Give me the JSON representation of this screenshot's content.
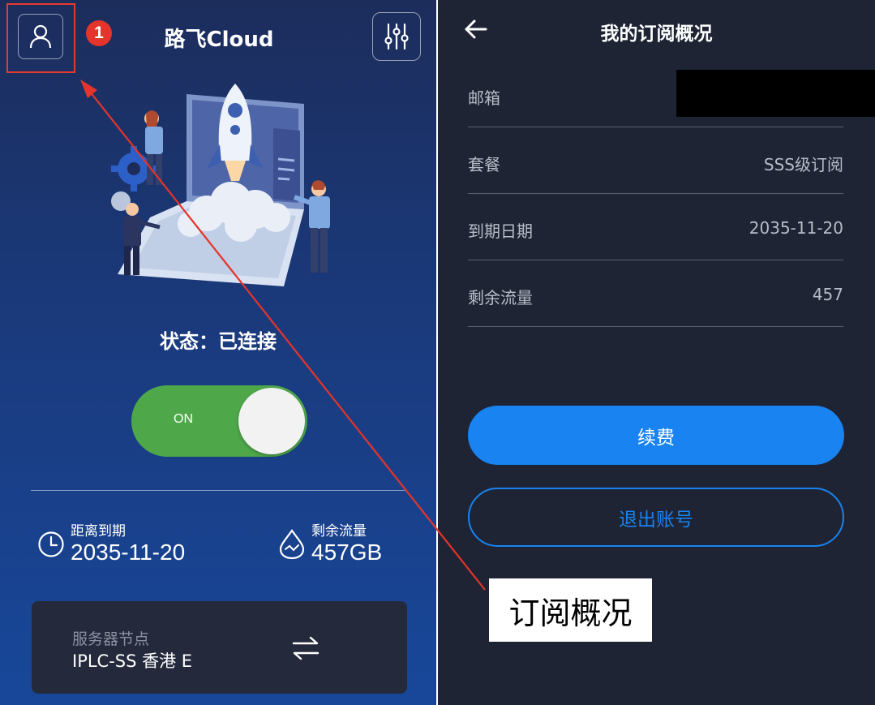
{
  "left": {
    "app_title": "路飞Cloud",
    "step_badge": "1",
    "status_text": "状态：已连接",
    "toggle_label": "ON",
    "expire": {
      "caption": "距离到期",
      "value": "2035-11-20"
    },
    "traffic": {
      "caption": "剩余流量",
      "value": "457GB"
    },
    "server": {
      "caption": "服务器节点",
      "value": "IPLC-SS 香港 E"
    }
  },
  "right": {
    "title": "我的订阅概况",
    "rows": [
      {
        "label": "邮箱",
        "value": ""
      },
      {
        "label": "套餐",
        "value": "SSS级订阅"
      },
      {
        "label": "到期日期",
        "value": "2035-11-20"
      },
      {
        "label": "剩余流量",
        "value": "457"
      }
    ],
    "renew_label": "续费",
    "logout_label": "退出账号"
  },
  "annotation": {
    "callout_text": "订阅概况"
  },
  "icons": {
    "user": "user-icon",
    "settings": "sliders-icon",
    "back": "arrow-left-icon",
    "clock": "clock-icon",
    "drop": "water-drop-icon",
    "swap": "swap-icon"
  },
  "colors": {
    "toggle_on": "#4ea84a",
    "accent_blue": "#1883f1",
    "annotation_red": "#e5342b",
    "right_bg": "#1e2433"
  }
}
